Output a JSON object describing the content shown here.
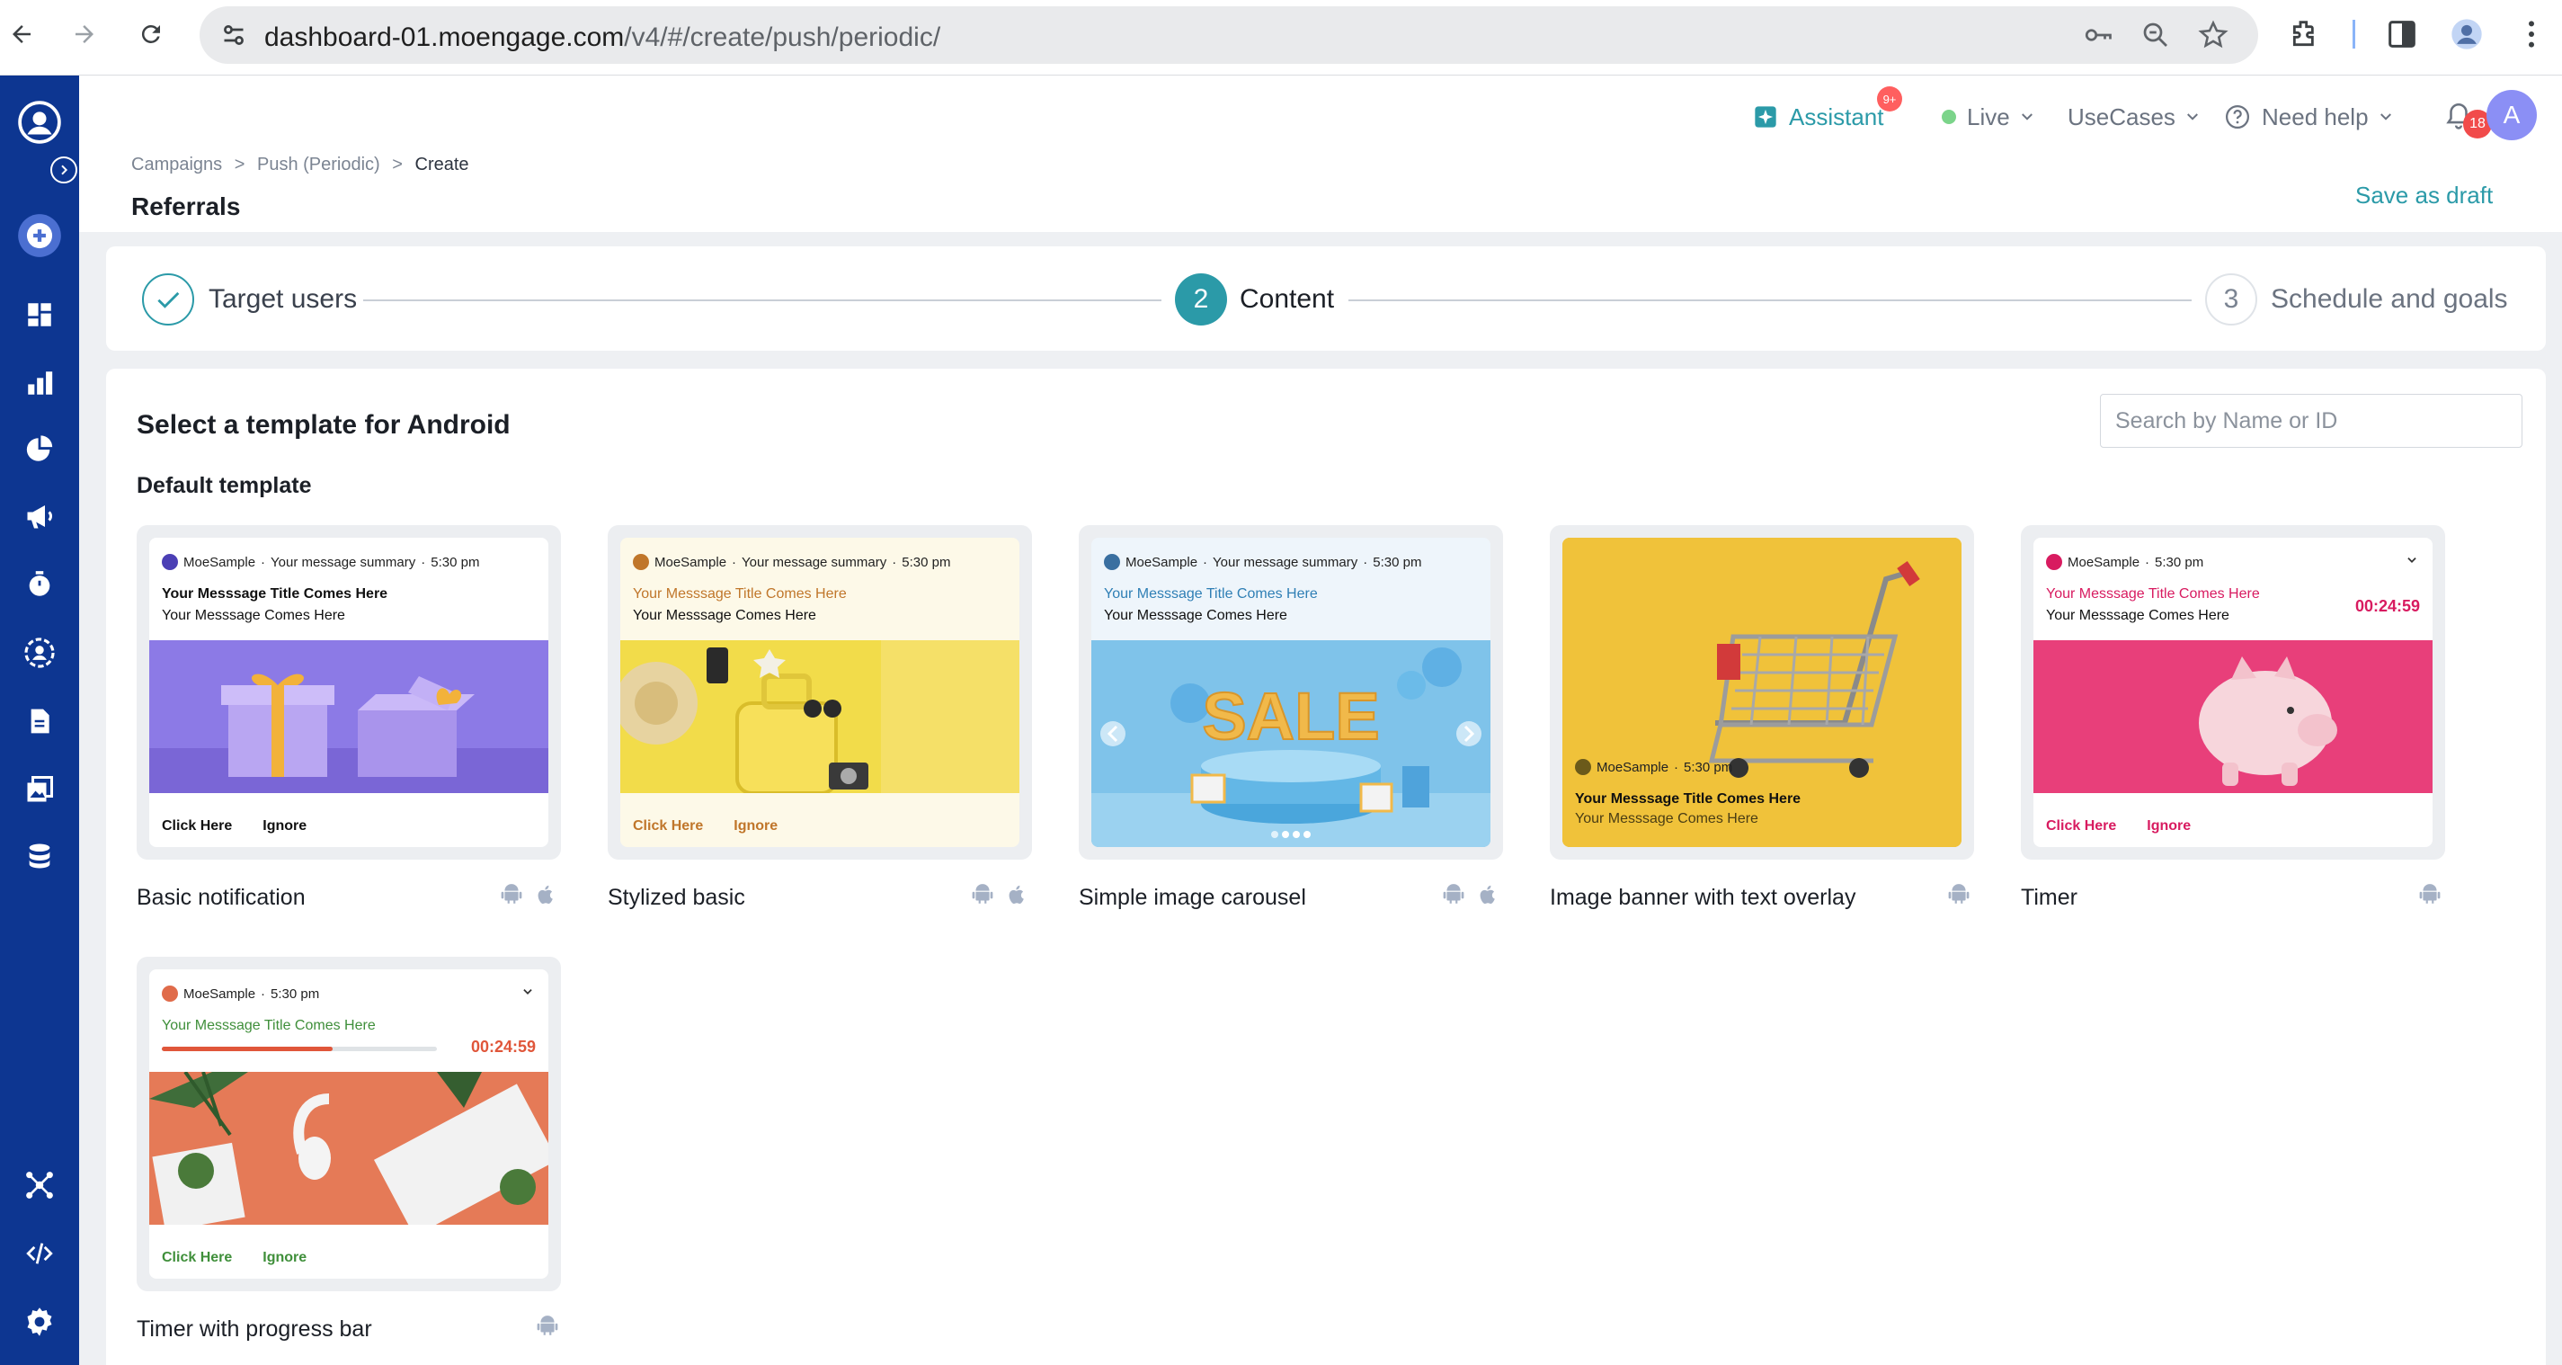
{
  "browser": {
    "url_host": "dashboard-01.moengage.com",
    "url_path": "/v4/#/create/push/periodic/"
  },
  "header": {
    "assistant_label": "Assistant",
    "assistant_badge": "9+",
    "live_label": "Live",
    "usecases_label": "UseCases",
    "help_label": "Need help",
    "notif_count": "18",
    "avatar_initial": "A"
  },
  "breadcrumb": {
    "items": [
      "Campaigns",
      "Push (Periodic)"
    ],
    "separator": ">",
    "current": "Create"
  },
  "page": {
    "title": "Referrals",
    "save_draft": "Save as draft"
  },
  "stepper": {
    "steps": [
      {
        "number": "1",
        "label": "Target users",
        "state": "done"
      },
      {
        "number": "2",
        "label": "Content",
        "state": "active"
      },
      {
        "number": "3",
        "label": "Schedule and goals",
        "state": "pending"
      }
    ]
  },
  "content": {
    "section_title": "Select a template for Android",
    "subsection_title": "Default template",
    "search_placeholder": "Search by Name or ID"
  },
  "preview": {
    "app_name": "MoeSample",
    "summary": "Your message summary",
    "time": "5:30 pm",
    "title": "Your Messsage Title Comes Here",
    "body": "Your Messsage Comes Here",
    "click": "Click Here",
    "ignore": "Ignore",
    "timer": "00:24:59",
    "sep": "·"
  },
  "templates": [
    {
      "name": "Basic notification",
      "platforms": [
        "android",
        "ios"
      ]
    },
    {
      "name": "Stylized basic",
      "platforms": [
        "android",
        "ios"
      ]
    },
    {
      "name": "Simple image carousel",
      "platforms": [
        "android",
        "ios"
      ]
    },
    {
      "name": "Image banner with text overlay",
      "platforms": [
        "android"
      ]
    },
    {
      "name": "Timer",
      "platforms": [
        "android"
      ]
    },
    {
      "name": "Timer with progress bar",
      "platforms": [
        "android"
      ]
    }
  ],
  "colors": {
    "nav_bg": "#0d3691",
    "accent_teal": "#2b9aa8",
    "stylized_accent": "#c0762a",
    "timer_accent": "#d81b60",
    "progress_accent": "#3f8f3a"
  }
}
